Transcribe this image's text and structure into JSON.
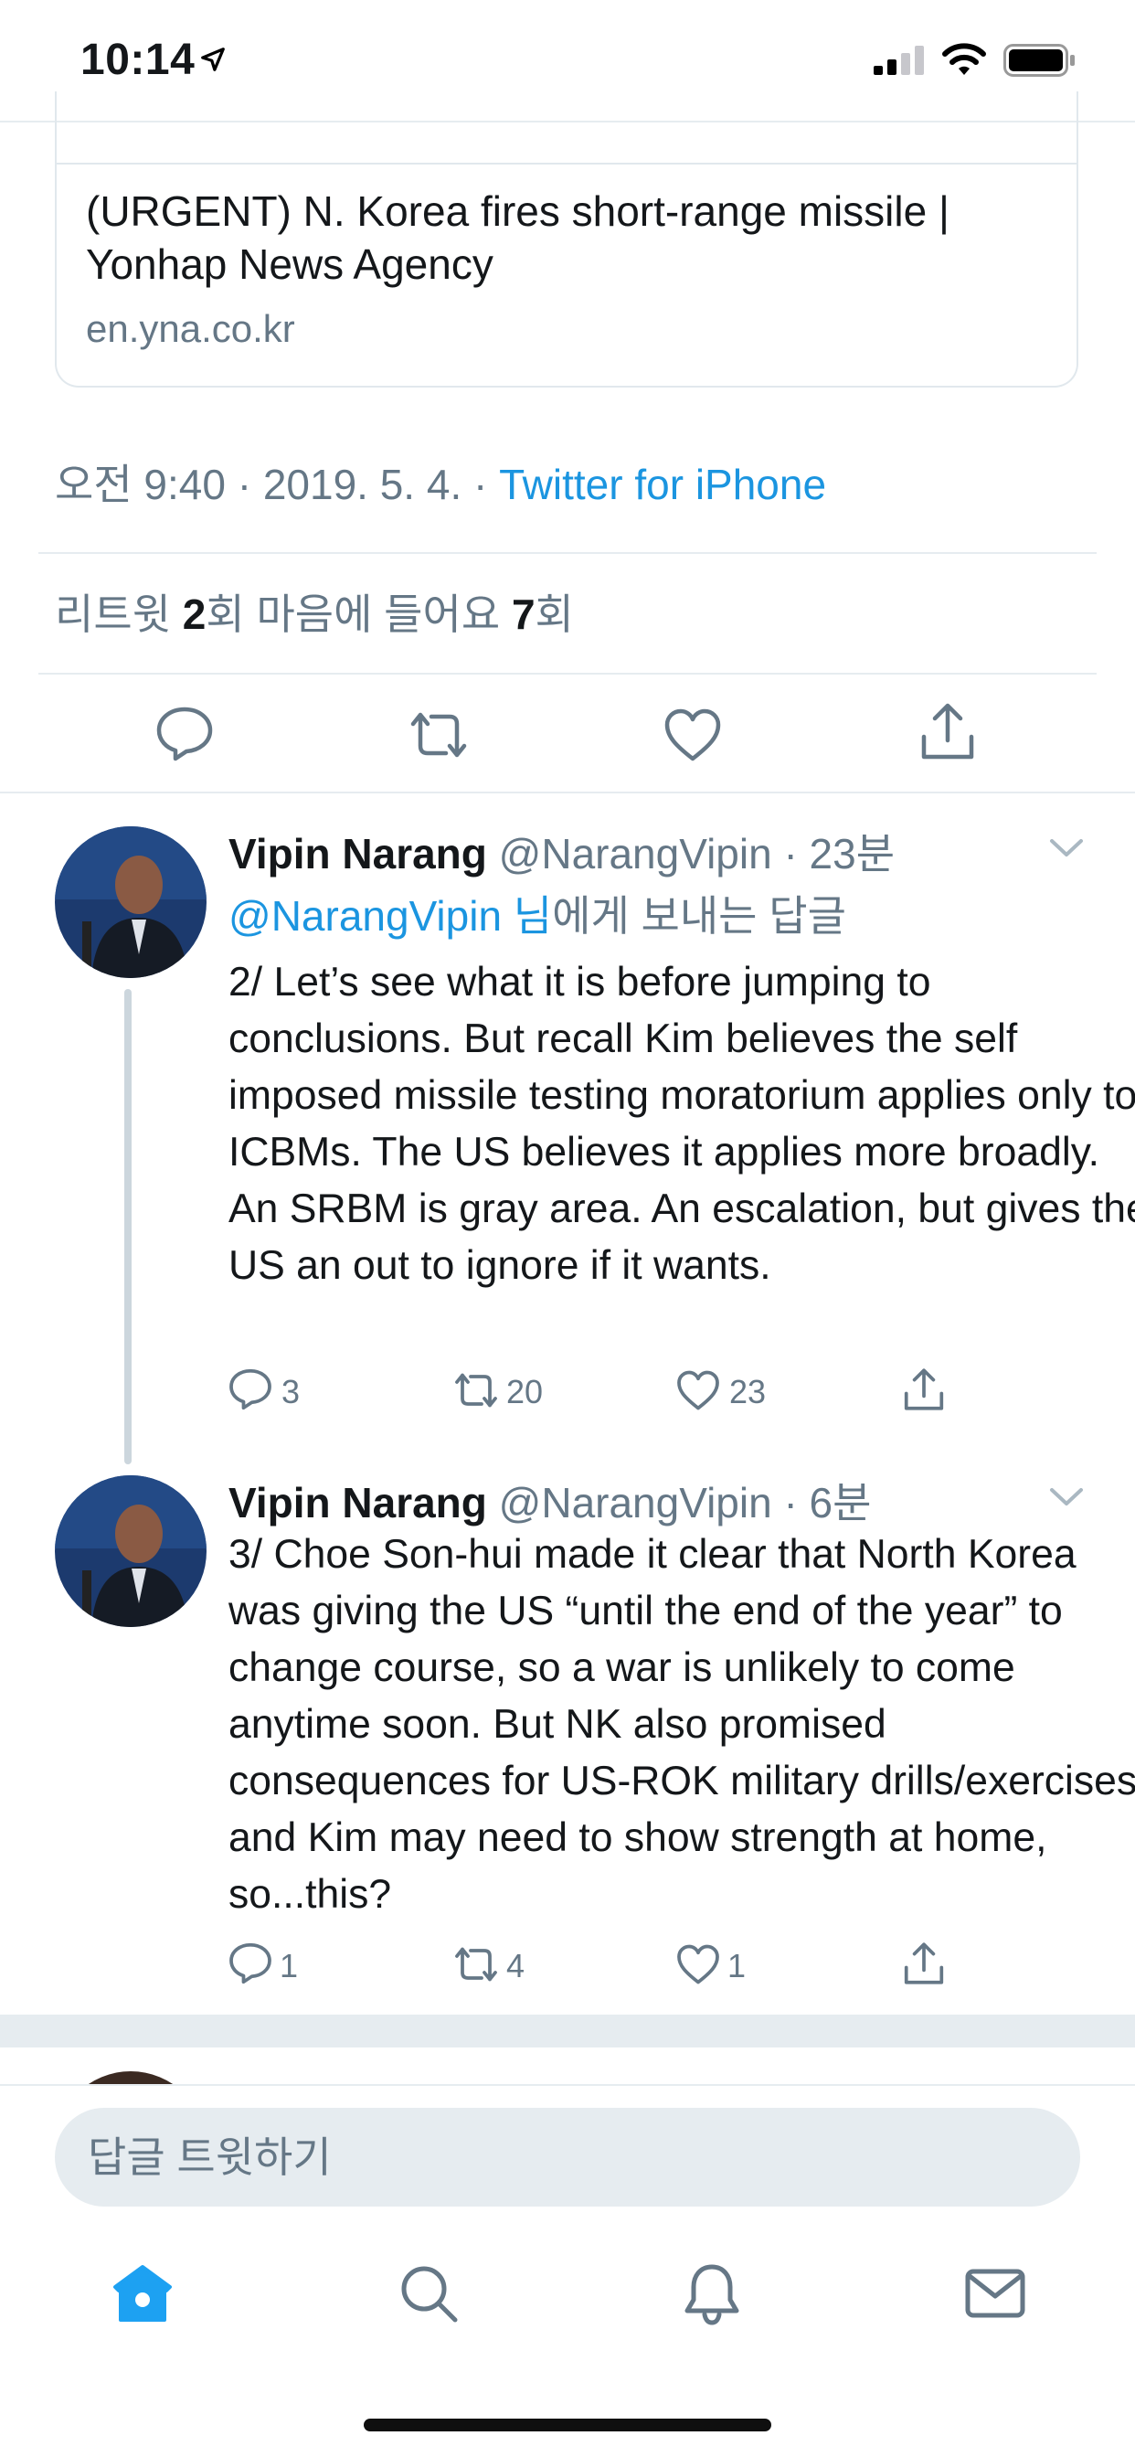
{
  "status_bar": {
    "time": "10:14"
  },
  "link_card": {
    "title": "(URGENT) N. Korea fires short-range missile | Yonhap News Agency",
    "domain": "en.yna.co.kr"
  },
  "tweet_meta": {
    "timestamp": "오전 9:40 · 2019. 5. 4. · ",
    "source": "Twitter for iPhone"
  },
  "stats": {
    "retweets_label": "리트윗 ",
    "retweets_count": "2",
    "retweets_suffix": "회  마음에 들어요 ",
    "likes_count": "7",
    "likes_suffix": "회"
  },
  "replies": [
    {
      "name": "Vipin Narang",
      "handle_time": " @NarangVipin · 23분",
      "reply_to_handle": "@NarangVipin 님",
      "reply_to_suffix": "에게 보내는 답글",
      "text": "2/ Let’s see what it is before jumping to conclusions. But recall Kim believes the self imposed missile testing moratorium applies only to ICBMs. The US believes it applies more broadly. An SRBM is gray area. An escalation, but gives the US an out to ignore if it wants.",
      "reply_count": "3",
      "retweet_count": "20",
      "like_count": "23"
    },
    {
      "name": "Vipin Narang",
      "handle_time": " @NarangVipin · 6분",
      "text": "3/ Choe Son-hui made it clear that North Korea was giving the US “until the end of the year” to change course, so a war is unlikely to come anytime soon. But NK also promised consequences for US-ROK military drills/exercises, and Kim may need to show strength at home, so...this?",
      "reply_count": "1",
      "retweet_count": "4",
      "like_count": "1"
    }
  ],
  "compose": {
    "placeholder": "답글 트윗하기"
  },
  "colors": {
    "accent": "#1b95e0",
    "muted": "#657786",
    "text": "#14171a",
    "divider": "#e6ecf0"
  },
  "icons": [
    "location-arrow-icon",
    "signal-icon",
    "wifi-icon",
    "battery-icon",
    "reply-icon",
    "retweet-icon",
    "like-icon",
    "share-icon",
    "chevron-down-icon",
    "home-icon",
    "search-icon",
    "notifications-icon",
    "messages-icon"
  ]
}
